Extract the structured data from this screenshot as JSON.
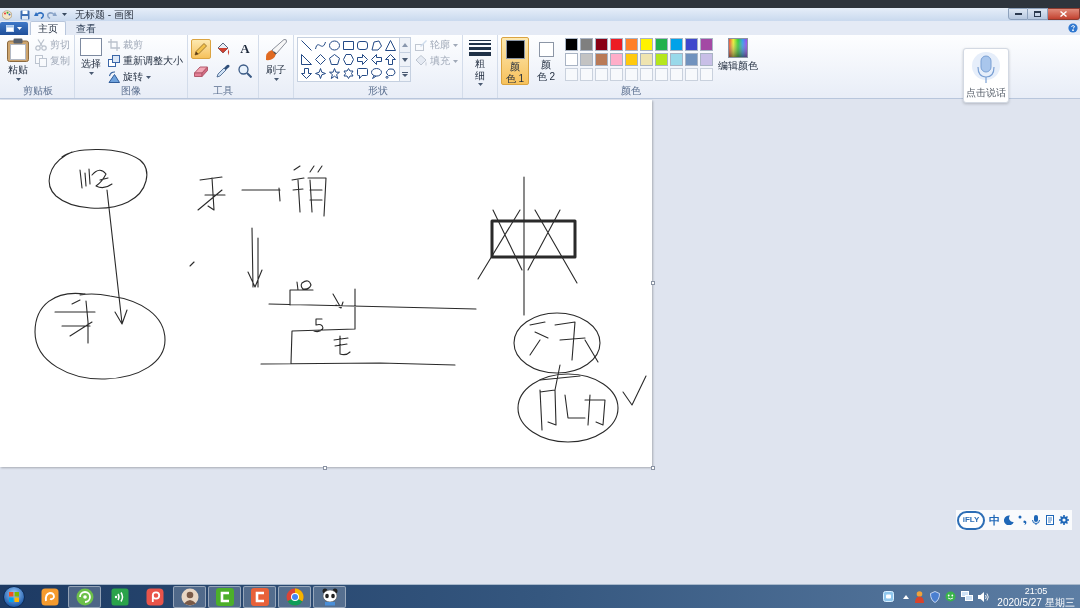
{
  "window": {
    "title": "无标题 - 画图"
  },
  "tabs": [
    {
      "label": "主页",
      "selected": true
    },
    {
      "label": "查看",
      "selected": false
    }
  ],
  "ribbon": {
    "clipboard": {
      "label": "剪贴板",
      "paste": "粘贴",
      "commands": [
        {
          "kind": "cut",
          "label": "剪切",
          "disabled": true
        },
        {
          "kind": "copy",
          "label": "复制",
          "disabled": true
        }
      ]
    },
    "image": {
      "label": "图像",
      "select": "选择",
      "commands": [
        {
          "kind": "crop",
          "label": "裁剪",
          "disabled": true
        },
        {
          "kind": "resize",
          "label": "重新调整大小",
          "disabled": false
        },
        {
          "kind": "rotate",
          "label": "旋转",
          "disabled": false
        }
      ]
    },
    "tools": {
      "label": "工具",
      "items": [
        {
          "kind": "pencil",
          "selected": true
        },
        {
          "kind": "fill",
          "selected": false
        },
        {
          "kind": "text",
          "glyph": "A",
          "selected": false
        },
        {
          "kind": "eraser",
          "selected": false
        },
        {
          "kind": "picker",
          "selected": false
        },
        {
          "kind": "magnifier",
          "selected": false
        }
      ]
    },
    "brushes": {
      "label": "刷子"
    },
    "shapes": {
      "label": "形状",
      "commands": [
        {
          "kind": "outline",
          "label": "轮廓",
          "disabled": true
        },
        {
          "kind": "fill",
          "label": "填充",
          "disabled": true
        }
      ]
    },
    "size": {
      "label": "粗细"
    },
    "colors": {
      "label": "颜色",
      "active": [
        {
          "label": "颜色 1",
          "color": "#000000",
          "selected": true
        },
        {
          "label": "颜色 2",
          "color": "#ffffff",
          "selected": false
        }
      ],
      "palette": [
        {
          "kind": "swatch",
          "color": "#000000"
        },
        {
          "kind": "swatch",
          "color": "#7f7f7f"
        },
        {
          "kind": "swatch",
          "color": "#880015"
        },
        {
          "kind": "swatch",
          "color": "#ed1c24"
        },
        {
          "kind": "swatch",
          "color": "#ff7f27"
        },
        {
          "kind": "swatch",
          "color": "#fff200"
        },
        {
          "kind": "swatch",
          "color": "#22b14c"
        },
        {
          "kind": "swatch",
          "color": "#00a2e8"
        },
        {
          "kind": "swatch",
          "color": "#3f48cc"
        },
        {
          "kind": "swatch",
          "color": "#a349a4"
        },
        {
          "kind": "swatch",
          "color": "#ffffff"
        },
        {
          "kind": "swatch",
          "color": "#c3c3c3"
        },
        {
          "kind": "swatch",
          "color": "#b97a57"
        },
        {
          "kind": "swatch",
          "color": "#ffaec9"
        },
        {
          "kind": "swatch",
          "color": "#ffc90e"
        },
        {
          "kind": "swatch",
          "color": "#efe4b0"
        },
        {
          "kind": "swatch",
          "color": "#b5e61d"
        },
        {
          "kind": "swatch",
          "color": "#99d9ea"
        },
        {
          "kind": "swatch",
          "color": "#7092be"
        },
        {
          "kind": "swatch",
          "color": "#c8bfe7"
        },
        {
          "kind": "empty"
        },
        {
          "kind": "empty"
        },
        {
          "kind": "empty"
        },
        {
          "kind": "empty"
        },
        {
          "kind": "empty"
        },
        {
          "kind": "empty"
        },
        {
          "kind": "empty"
        },
        {
          "kind": "empty"
        },
        {
          "kind": "empty"
        },
        {
          "kind": "empty"
        }
      ],
      "edit": "编辑颜色"
    }
  },
  "voice_input": {
    "label": "点击说话"
  },
  "ime_bar": {
    "logo": "iFLY",
    "mode": "中"
  },
  "taskbar": {
    "apps": [
      {
        "kind": "tile",
        "running": false
      },
      {
        "kind": "swirl",
        "running": true
      },
      {
        "kind": "wave-tile",
        "running": false
      },
      {
        "kind": "pin-tile",
        "running": false
      },
      {
        "kind": "avatar",
        "running": true
      },
      {
        "kind": "bracket-tile",
        "color": "#4caf2a",
        "running": true
      },
      {
        "kind": "bracket-tile",
        "color": "#e8613a",
        "running": true
      },
      {
        "kind": "round-logo",
        "running": true
      },
      {
        "kind": "panda",
        "running": true
      }
    ],
    "clock": {
      "time": "21:05",
      "date": "2020/5/27 星期三"
    }
  }
}
